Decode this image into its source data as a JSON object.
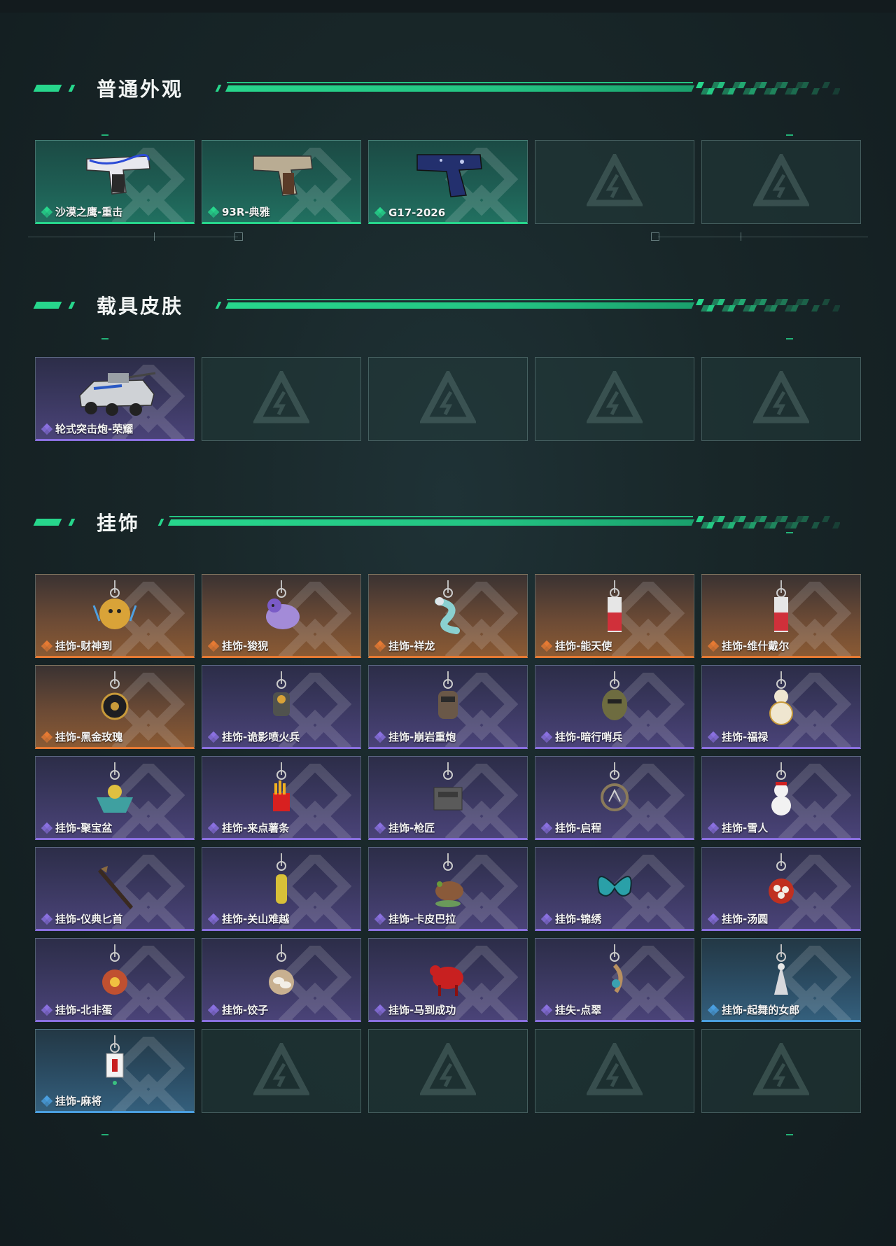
{
  "sections": [
    {
      "title": "普通外观",
      "items": [
        {
          "name": "沙漠之鹰-重击",
          "rarity": "green",
          "icon": "pistol-white-blue-icon"
        },
        {
          "name": "93R-典雅",
          "rarity": "green",
          "icon": "pistol-tan-icon"
        },
        {
          "name": "G17-2026",
          "rarity": "green",
          "icon": "pistol-navy-icon"
        },
        {
          "name": "",
          "rarity": "empty"
        },
        {
          "name": "",
          "rarity": "empty"
        }
      ]
    },
    {
      "title": "载具皮肤",
      "items": [
        {
          "name": "轮式突击炮-荣耀",
          "rarity": "purple",
          "icon": "armored-vehicle-icon"
        },
        {
          "name": "",
          "rarity": "empty"
        },
        {
          "name": "",
          "rarity": "empty"
        },
        {
          "name": "",
          "rarity": "empty"
        },
        {
          "name": "",
          "rarity": "empty"
        }
      ]
    },
    {
      "title": "挂饰",
      "items": [
        {
          "name": "挂饰-财神到",
          "rarity": "orange",
          "icon": "charm-fortune-god-icon"
        },
        {
          "name": "挂饰-狻猊",
          "rarity": "orange",
          "icon": "charm-lion-icon"
        },
        {
          "name": "挂饰-祥龙",
          "rarity": "orange",
          "icon": "charm-dragon-icon"
        },
        {
          "name": "挂饰-能天使",
          "rarity": "orange",
          "icon": "charm-red-tag-icon"
        },
        {
          "name": "挂饰-维什戴尔",
          "rarity": "orange",
          "icon": "charm-red-tag-icon"
        },
        {
          "name": "挂饰-黑金玫瑰",
          "rarity": "orange",
          "icon": "charm-black-rose-icon"
        },
        {
          "name": "挂饰-诡影喷火兵",
          "rarity": "purple",
          "icon": "charm-flamethrower-icon"
        },
        {
          "name": "挂饰-崩岩重炮",
          "rarity": "purple",
          "icon": "charm-heavy-gunner-icon"
        },
        {
          "name": "挂饰-暗行哨兵",
          "rarity": "purple",
          "icon": "charm-sentry-icon"
        },
        {
          "name": "挂饰-福禄",
          "rarity": "purple",
          "icon": "charm-gourd-icon"
        },
        {
          "name": "挂饰-聚宝盆",
          "rarity": "purple",
          "icon": "charm-treasure-bowl-icon"
        },
        {
          "name": "挂饰-来点薯条",
          "rarity": "purple",
          "icon": "charm-fries-icon"
        },
        {
          "name": "挂饰-枪匠",
          "rarity": "purple",
          "icon": "charm-gunsmith-icon"
        },
        {
          "name": "挂饰-启程",
          "rarity": "purple",
          "icon": "charm-ring-icon"
        },
        {
          "name": "挂饰-雪人",
          "rarity": "purple",
          "icon": "charm-snowman-icon"
        },
        {
          "name": "挂饰-仪典匕首",
          "rarity": "purple",
          "icon": "charm-dagger-icon"
        },
        {
          "name": "挂饰-关山难越",
          "rarity": "purple",
          "icon": "charm-scroll-icon"
        },
        {
          "name": "挂饰-卡皮巴拉",
          "rarity": "purple",
          "icon": "charm-capybara-icon"
        },
        {
          "name": "挂饰-锦绣",
          "rarity": "purple",
          "icon": "charm-butterfly-icon"
        },
        {
          "name": "挂饰-汤圆",
          "rarity": "purple",
          "icon": "charm-tangyuan-icon"
        },
        {
          "name": "挂饰-北非蛋",
          "rarity": "purple",
          "icon": "charm-shakshuka-icon"
        },
        {
          "name": "挂饰-饺子",
          "rarity": "purple",
          "icon": "charm-dumpling-icon"
        },
        {
          "name": "挂饰-马到成功",
          "rarity": "purple",
          "icon": "charm-red-horse-icon"
        },
        {
          "name": "挂失-点翠",
          "rarity": "purple",
          "icon": "charm-hairpin-icon"
        },
        {
          "name": "挂饰-起舞的女郎",
          "rarity": "blue",
          "icon": "charm-dancer-icon"
        },
        {
          "name": "挂饰-麻将",
          "rarity": "blue",
          "icon": "charm-mahjong-icon"
        },
        {
          "name": "",
          "rarity": "empty"
        },
        {
          "name": "",
          "rarity": "empty"
        },
        {
          "name": "",
          "rarity": "empty"
        },
        {
          "name": "",
          "rarity": "empty"
        }
      ]
    }
  ],
  "colors": {
    "accent": "#27d68c",
    "green": "#27d68c",
    "purple": "#8a70e0",
    "orange": "#e67a33",
    "blue": "#4a9fe0"
  }
}
